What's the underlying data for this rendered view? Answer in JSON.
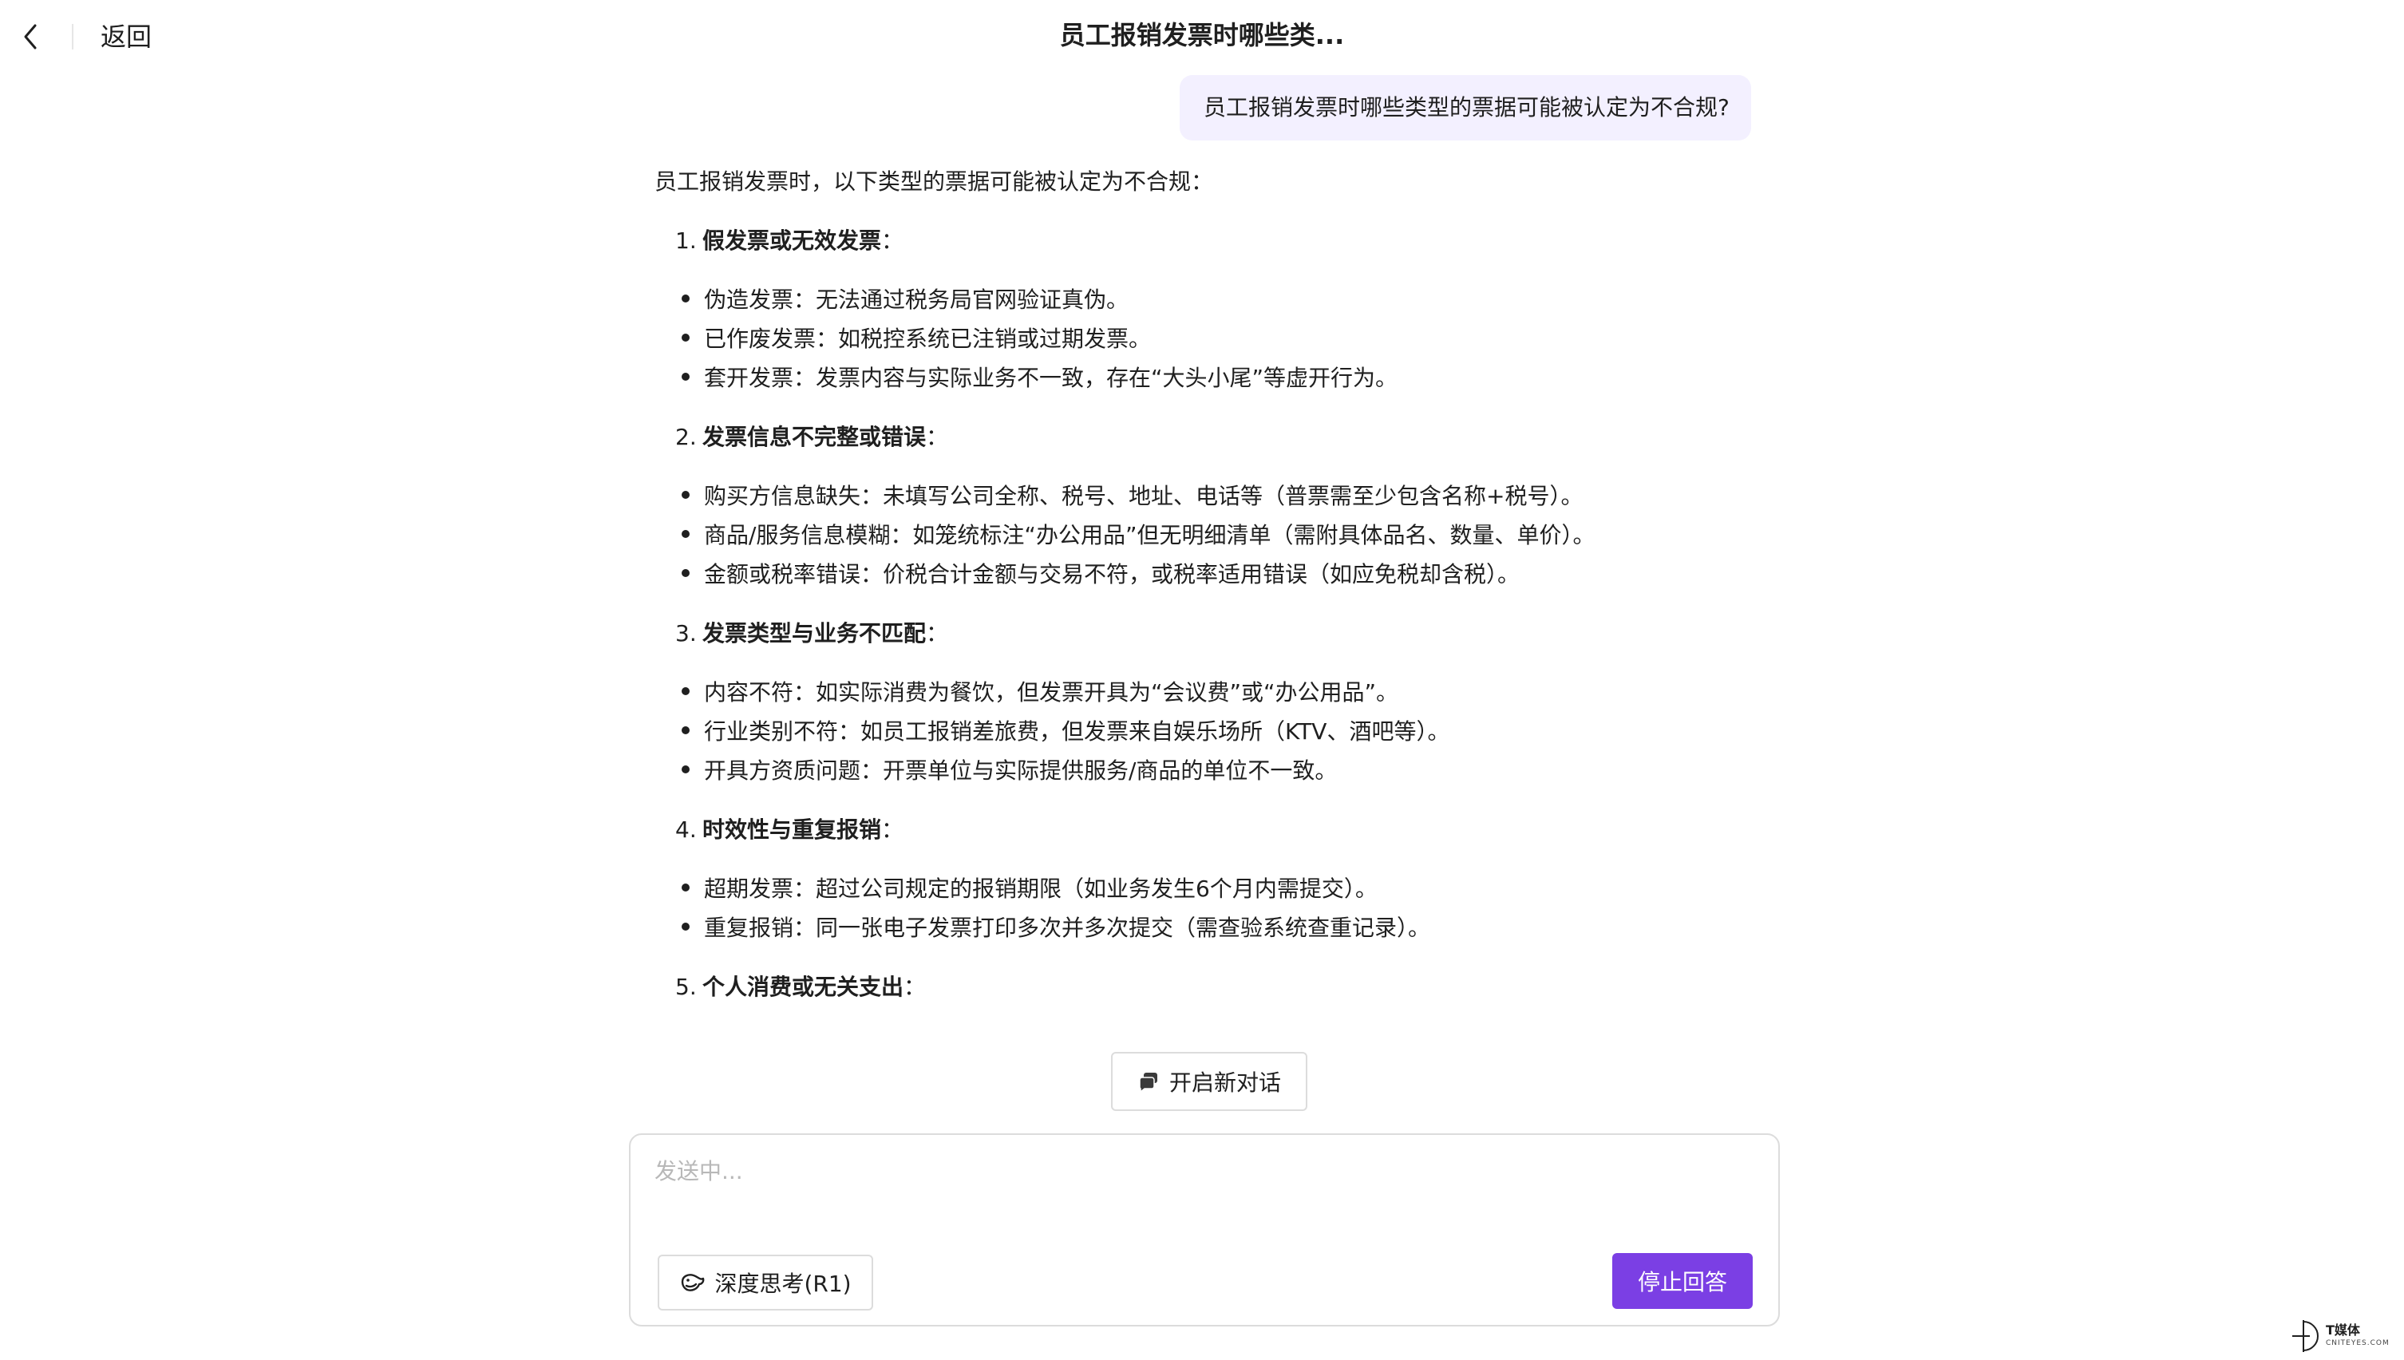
{
  "header": {
    "back_label": "返回",
    "title": "员工报销发票时哪些类..."
  },
  "user_message": "员工报销发票时哪些类型的票据可能被认定为不合规?",
  "answer": {
    "intro": "员工报销发票时，以下类型的票据可能被认定为不合规：",
    "sections": [
      {
        "num": "1.",
        "title": "假发票或无效发票",
        "suffix": "：",
        "bullets": [
          "伪造发票：无法通过税务局官网验证真伪。",
          "已作废发票：如税控系统已注销或过期发票。",
          "套开发票：发票内容与实际业务不一致，存在“大头小尾”等虚开行为。"
        ]
      },
      {
        "num": "2.",
        "title": "发票信息不完整或错误",
        "suffix": "：",
        "bullets": [
          "购买方信息缺失：未填写公司全称、税号、地址、电话等（普票需至少包含名称+税号）。",
          "商品/服务信息模糊：如笼统标注“办公用品”但无明细清单（需附具体品名、数量、单价）。",
          "金额或税率错误：价税合计金额与交易不符，或税率适用错误（如应免税却含税）。"
        ]
      },
      {
        "num": "3.",
        "title": "发票类型与业务不匹配",
        "suffix": "：",
        "bullets": [
          "内容不符：如实际消费为餐饮，但发票开具为“会议费”或“办公用品”。",
          "行业类别不符：如员工报销差旅费，但发票来自娱乐场所（KTV、酒吧等）。",
          "开具方资质问题：开票单位与实际提供服务/商品的单位不一致。"
        ]
      },
      {
        "num": "4.",
        "title": "时效性与重复报销",
        "suffix": "：",
        "bullets": [
          "超期发票：超过公司规定的报销期限（如业务发生6个月内需提交）。",
          "重复报销：同一张电子发票打印多次并多次提交（需查验系统查重记录）。"
        ]
      },
      {
        "num": "5.",
        "title": "个人消费或无关支出",
        "suffix": "：",
        "bullets": []
      }
    ]
  },
  "new_chat_label": "开启新对话",
  "input": {
    "placeholder": "发送中...",
    "value": ""
  },
  "deep_think_label": "深度思考(R1)",
  "stop_label": "停止回答",
  "watermark": {
    "title": "T媒体",
    "sub": "CNITEYES.COM"
  },
  "colors": {
    "accent": "#7b3fe4",
    "user_bubble": "#f3f0ff",
    "border": "#dcdcdc"
  }
}
